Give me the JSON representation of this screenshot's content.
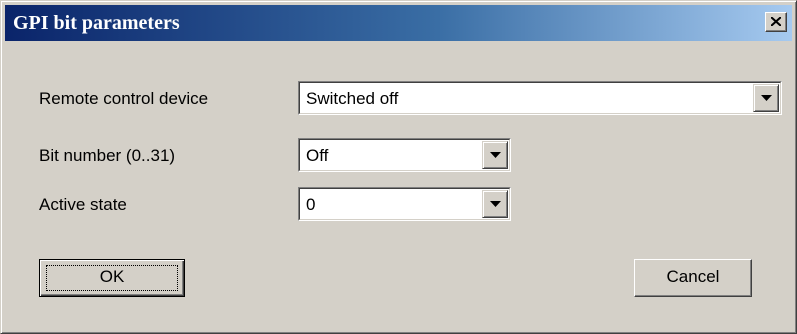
{
  "window": {
    "title": "GPI bit parameters",
    "close_icon": "close-icon"
  },
  "fields": {
    "remote_control_device": {
      "label": "Remote control device",
      "value": "Switched off"
    },
    "bit_number": {
      "label": "Bit number (0..31)",
      "value": "Off"
    },
    "active_state": {
      "label": "Active state",
      "value": "0"
    }
  },
  "buttons": {
    "ok": "OK",
    "cancel": "Cancel"
  },
  "colors": {
    "titlebar_start": "#0a246a",
    "titlebar_end": "#a6caf0",
    "dialog_face": "#d4d0c8"
  }
}
